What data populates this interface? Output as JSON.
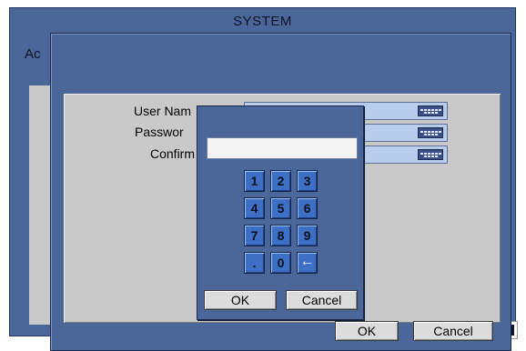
{
  "window": {
    "title": "SYSTEM",
    "section_label": "Ac"
  },
  "form": {
    "fields": [
      {
        "label": "User Nam",
        "value": ""
      },
      {
        "label": "Passwor",
        "value": ""
      },
      {
        "label": "Confirm",
        "value": ""
      }
    ],
    "ok_label": "OK",
    "cancel_label": "Cancel"
  },
  "keypad": {
    "input_value": "",
    "keys": [
      "1",
      "2",
      "3",
      "4",
      "5",
      "6",
      "7",
      "8",
      "9",
      ".",
      "0",
      "←"
    ],
    "ok_label": "OK",
    "cancel_label": "Cancel"
  },
  "colors": {
    "panel_blue": "#4b6698",
    "form_gray": "#c9c9c9",
    "key_blue": "#3d70c4",
    "field_blue": "#b8cceb"
  },
  "icons": {
    "field_icon": "keyboard-icon",
    "backspace_key": "backspace-arrow-icon"
  }
}
